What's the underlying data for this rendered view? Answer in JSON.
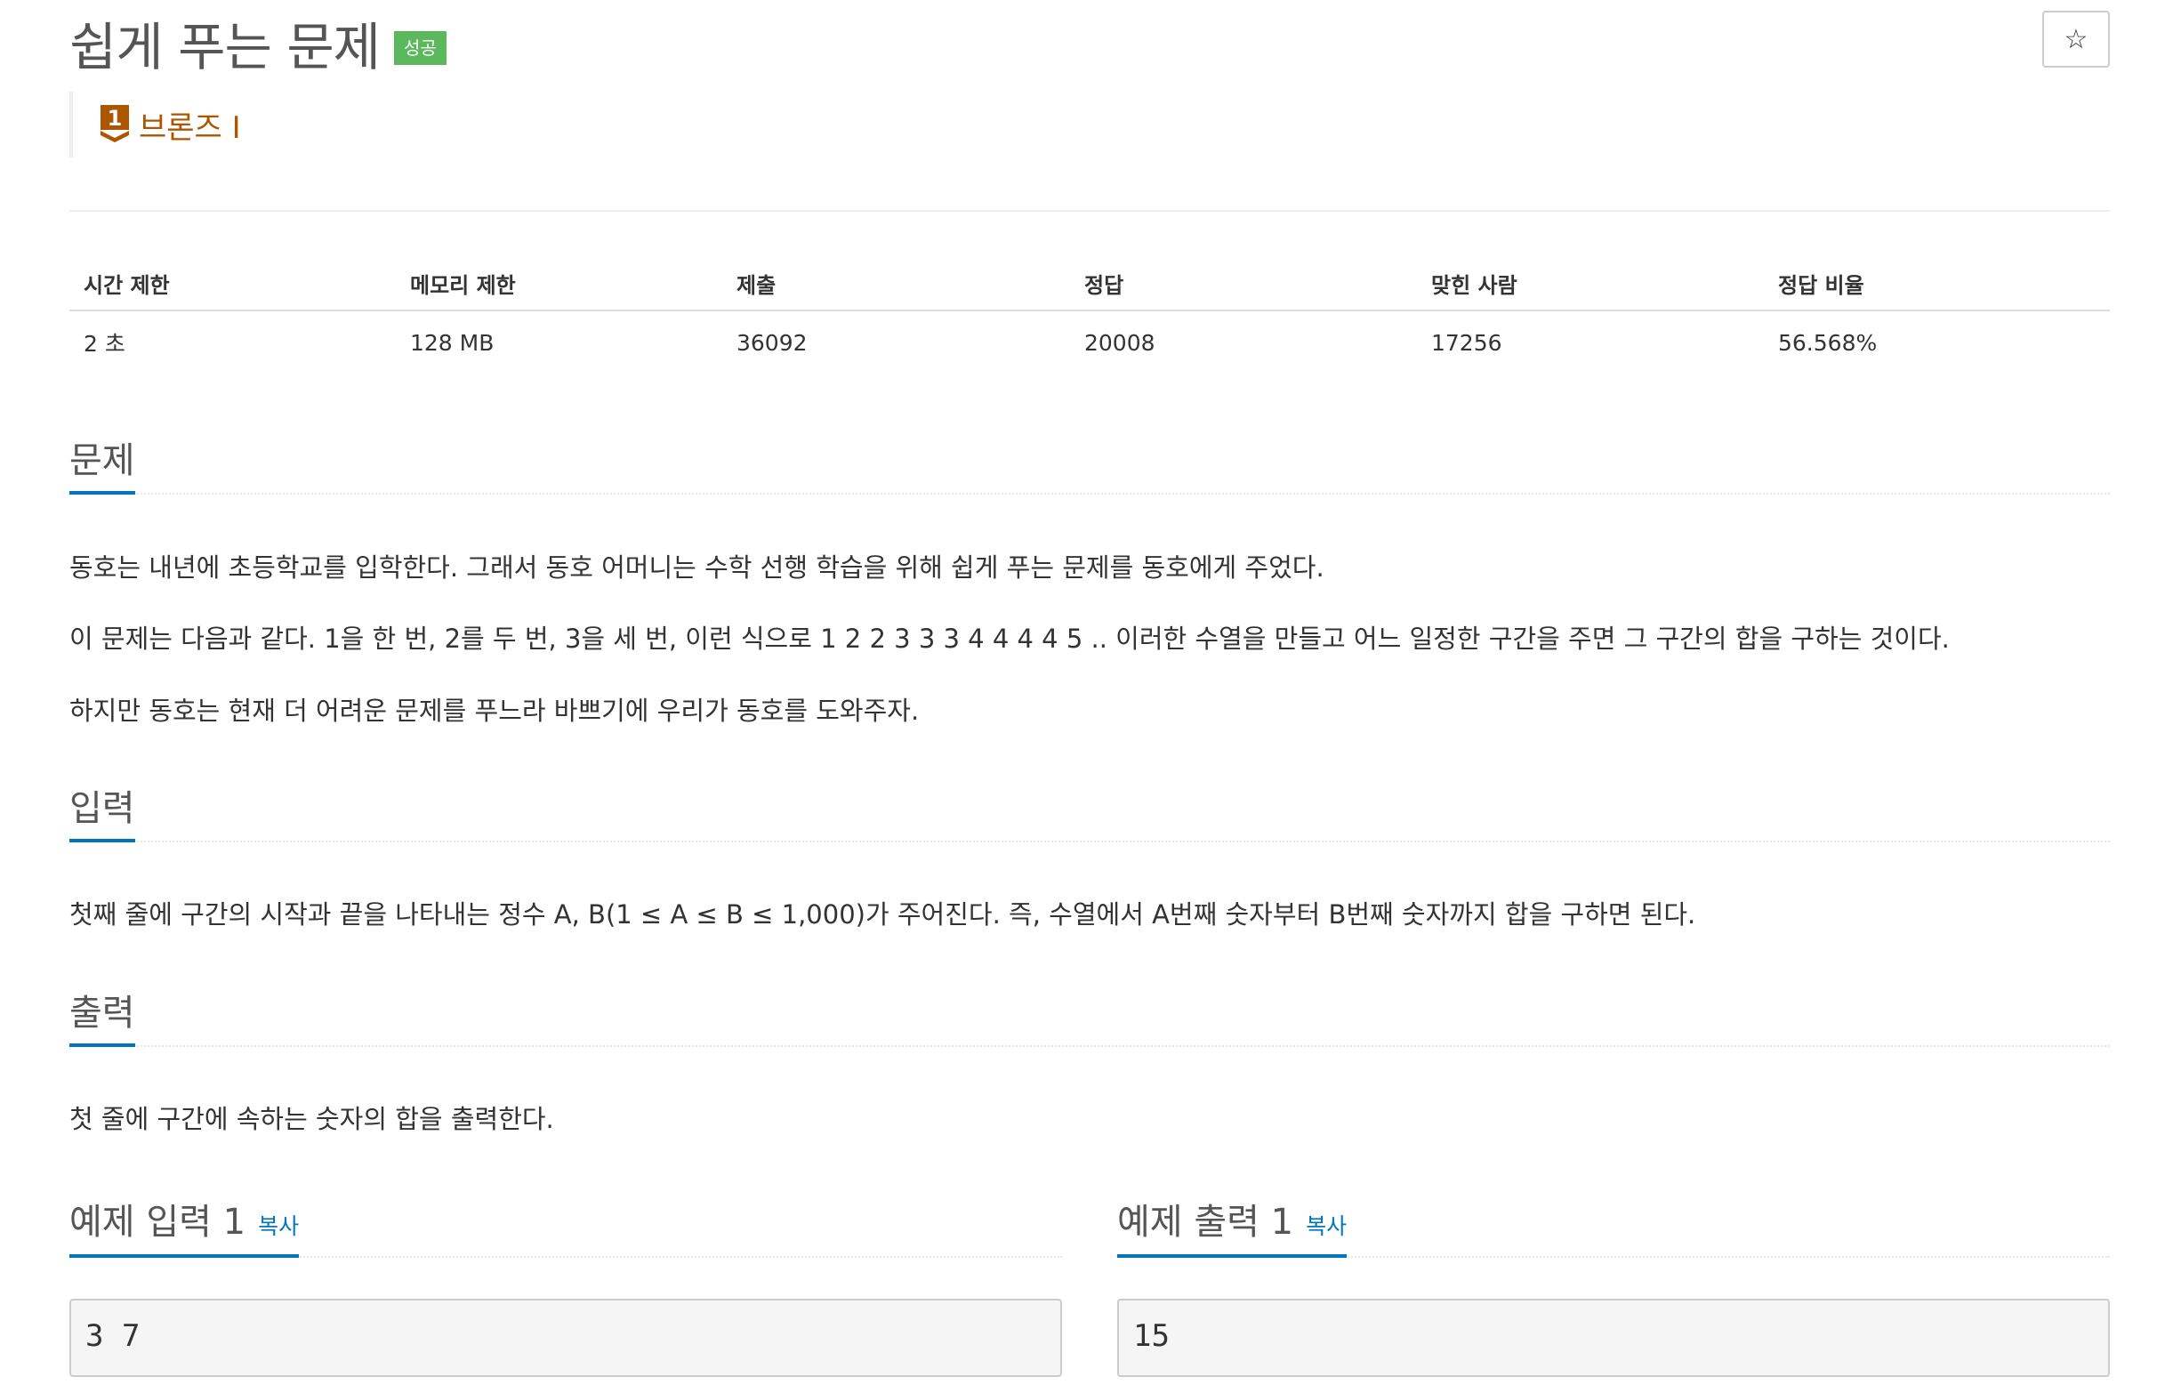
{
  "header": {
    "title": "쉽게 푸는 문제",
    "status_badge": "성공",
    "star_icon": "☆",
    "tier": {
      "number": "1",
      "label": "브론즈 I",
      "color": "#ad5600"
    }
  },
  "stats": {
    "headers": [
      "시간 제한",
      "메모리 제한",
      "제출",
      "정답",
      "맞힌 사람",
      "정답 비율"
    ],
    "values": [
      "2 초",
      "128 MB",
      "36092",
      "20008",
      "17256",
      "56.568%"
    ]
  },
  "sections": {
    "problem": {
      "title": "문제",
      "paragraphs": [
        "동호는 내년에 초등학교를 입학한다. 그래서 동호 어머니는 수학 선행 학습을 위해 쉽게 푸는 문제를 동호에게 주었다.",
        "이 문제는 다음과 같다. 1을 한 번, 2를 두 번, 3을 세 번, 이런 식으로 1 2 2 3 3 3 4 4 4 4 5 .. 이러한 수열을 만들고 어느 일정한 구간을 주면 그 구간의 합을 구하는 것이다.",
        "하지만 동호는 현재 더 어려운 문제를 푸느라 바쁘기에 우리가 동호를 도와주자."
      ]
    },
    "input": {
      "title": "입력",
      "text": "첫째 줄에 구간의 시작과 끝을 나타내는 정수 A, B(1 ≤ A ≤ B ≤ 1,000)가 주어진다. 즉, 수열에서 A번째 숫자부터 B번째 숫자까지 합을 구하면 된다."
    },
    "output": {
      "title": "출력",
      "text": "첫 줄에 구간에 속하는 숫자의 합을 출력한다."
    }
  },
  "examples": {
    "input": {
      "title": "예제 입력 1",
      "copy_label": "복사",
      "content": "3 7"
    },
    "output": {
      "title": "예제 출력 1",
      "copy_label": "복사",
      "content": "15"
    }
  },
  "colors": {
    "accent": "#0076c0",
    "success": "#5cb85c",
    "bronze": "#ad5600"
  }
}
